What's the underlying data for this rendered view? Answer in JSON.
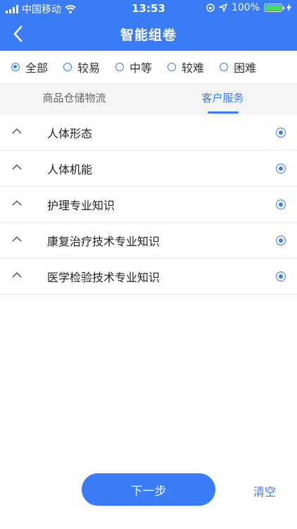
{
  "status_bar": {
    "carrier": "中国移动",
    "time": "13:53",
    "battery_percent": "100%"
  },
  "header": {
    "title": "智能组卷"
  },
  "difficulty": {
    "options": [
      "全部",
      "较易",
      "中等",
      "较难",
      "困难"
    ],
    "selected": "全部"
  },
  "tabs": [
    {
      "label": "商品仓储物流",
      "active": false
    },
    {
      "label": "客户服务",
      "active": true
    }
  ],
  "items": [
    {
      "label": "人体形态",
      "selected": true
    },
    {
      "label": "人体机能",
      "selected": true
    },
    {
      "label": "护理专业知识",
      "selected": true
    },
    {
      "label": "康复治疗技术专业知识",
      "selected": true
    },
    {
      "label": "医学检验技术专业知识",
      "selected": true
    }
  ],
  "footer": {
    "next_label": "下一步",
    "clear_label": "清空"
  },
  "colors": {
    "accent": "#3a7bf6",
    "battery": "#4cd964"
  }
}
